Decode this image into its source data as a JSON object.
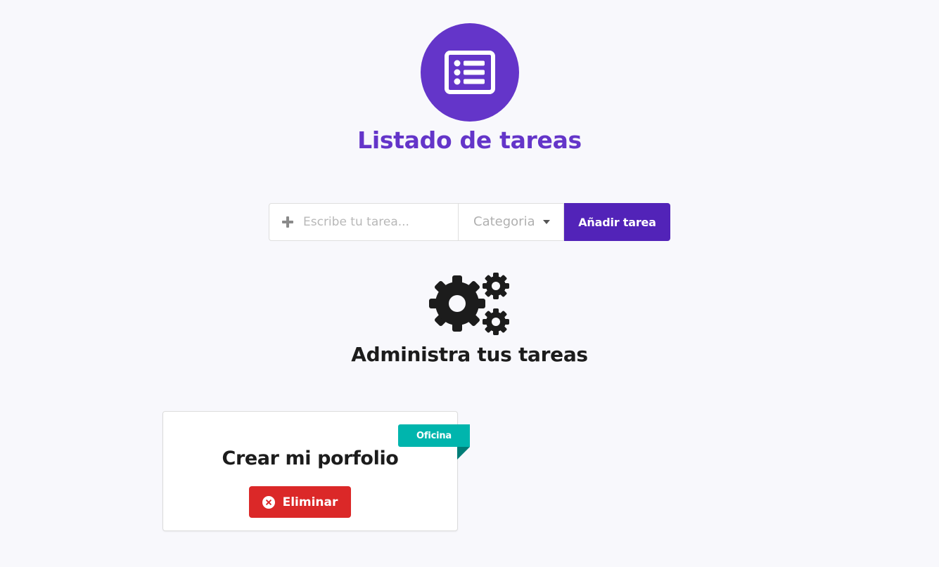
{
  "header": {
    "logo_icon": "list-alt-icon",
    "title": "Listado de tareas",
    "accent_color": "#6435c9"
  },
  "form": {
    "task_placeholder": "Escribe tu tarea...",
    "task_value": "",
    "add_icon": "plus-icon",
    "category_placeholder": "Categoria",
    "category_icon": "caret-down-icon",
    "add_button_label": "Añadir tarea",
    "add_button_color": "#5223b8"
  },
  "section": {
    "icon": "cogs-icon",
    "title": "Administra tus tareas"
  },
  "tasks": [
    {
      "title": "Crear mi porfolio",
      "category": "Oficina",
      "category_color": "#00b5ad",
      "delete_label": "Eliminar",
      "delete_icon": "times-circle-icon",
      "delete_color": "#db2828"
    }
  ]
}
